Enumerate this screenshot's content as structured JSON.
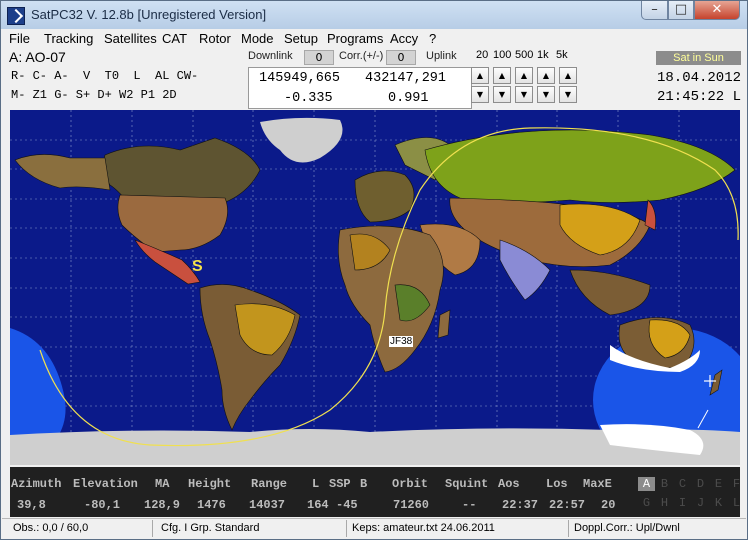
{
  "window": {
    "title": "SatPC32 V. 12.8b  [Unregistered Version]"
  },
  "menu": [
    {
      "label": "File"
    },
    {
      "label": "Tracking"
    },
    {
      "label": "Satellites"
    },
    {
      "label": "CAT"
    },
    {
      "label": "Rotor"
    },
    {
      "label": "Mode"
    },
    {
      "label": "Setup"
    },
    {
      "label": "Programs"
    },
    {
      "label": "Accy"
    },
    {
      "label": "?"
    }
  ],
  "satellite": {
    "name": "A: AO-07",
    "flags_row1": "R- C- A-  V  T0  L  AL CW-",
    "flags_row2": "M- Z1 G- S+ D+ W2 P1 2D"
  },
  "doppler": {
    "downlink_label": "Downlink",
    "downlink_value": "0",
    "corr_label": "Corr.(+/-)",
    "corr_value": "0",
    "uplink_label": "Uplink",
    "steps": [
      "20",
      "100",
      "500",
      "1k",
      "5k"
    ],
    "freq_down": "145949,665",
    "freq_up": "432147,291",
    "shift_down": "-0.335",
    "shift_up": "0.991"
  },
  "status": {
    "sun": "Sat in Sun",
    "date": "18.04.2012",
    "time": "21:45:22 L"
  },
  "map": {
    "locator": "JF38",
    "sat_symbol": "S",
    "colors": {
      "ocean": "#0b1a8a",
      "track": "#f0e050",
      "footprint": "#1a55e8",
      "ice": "#cfcfcf"
    }
  },
  "table": {
    "headers": {
      "azimuth": "Azimuth",
      "elevation": "Elevation",
      "ma": "MA",
      "height": "Height",
      "range": "Range",
      "l": "L",
      "ssp": "SSP",
      "b": "B",
      "orbit": "Orbit",
      "squint": "Squint",
      "aos": "Aos",
      "los": "Los",
      "maxe": "MaxE"
    },
    "values": {
      "azimuth": "39,8",
      "elevation": "-80,1",
      "ma": "128,9",
      "height": "1476",
      "range": "14037",
      "l": "164",
      "ssp": "-45",
      "orbit": "71260",
      "squint": "--",
      "aos": "22:37",
      "los": "22:57",
      "maxe": "20"
    }
  },
  "satellite_slots": [
    "A",
    "B",
    "C",
    "D",
    "E",
    "F",
    "G",
    "H",
    "I",
    "J",
    "K",
    "L"
  ],
  "statusbar": {
    "obs": "Obs.: 0,0 / 60,0",
    "cfg": "Cfg. I  Grp. Standard",
    "keps": "Keps: amateur.txt 24.06.2011",
    "doppl": "Doppl.Corr.: Upl/Dwnl"
  }
}
